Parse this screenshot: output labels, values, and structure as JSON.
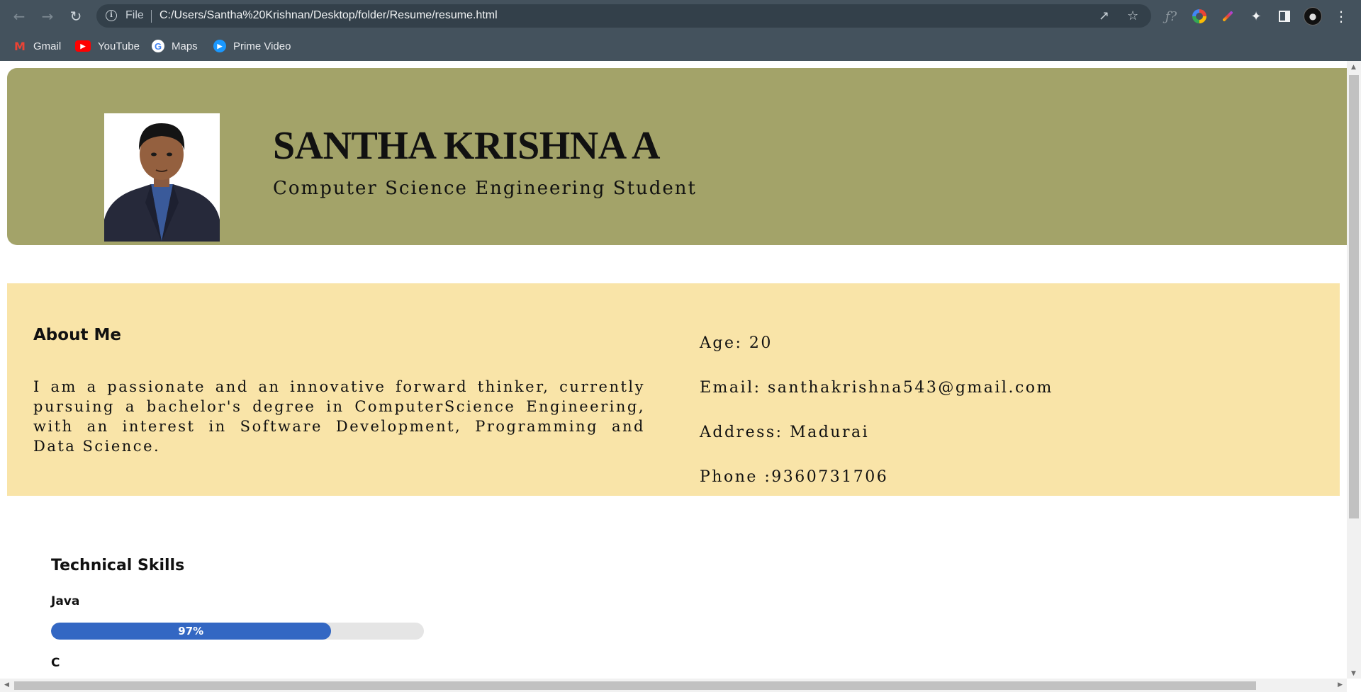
{
  "browser": {
    "omnibox": {
      "scheme_label": "File",
      "url": "C:/Users/Santha%20Krishnan/Desktop/folder/Resume/resume.html"
    },
    "bookmarks": [
      {
        "label": "Gmail",
        "icon": "gmail-icon"
      },
      {
        "label": "YouTube",
        "icon": "youtube-icon"
      },
      {
        "label": "Maps",
        "icon": "maps-icon"
      },
      {
        "label": "Prime Video",
        "icon": "prime-video-icon"
      }
    ]
  },
  "resume": {
    "name": "SANTHA KRISHNA A",
    "subtitle": "Computer Science Engineering Student",
    "about": {
      "title": "About Me",
      "text": "I am a passionate and an innovative forward thinker, currently pursuing a bachelor's degree in ComputerScience Engineering, with an interest in Software Development, Programming and Data Science."
    },
    "info": {
      "age": "Age: 20",
      "email": "Email: santhakrishna543@gmail.com",
      "address": "Address: Madurai",
      "phone": "Phone :9360731706"
    },
    "skills": {
      "title": "Technical Skills",
      "items": [
        {
          "name": "Java",
          "percent_label": "97%",
          "level": 0.75
        },
        {
          "name": "C"
        }
      ]
    }
  },
  "colors": {
    "header_bg": "#a3a369",
    "about_bg": "#f9e4a8",
    "skill_fill": "#3367c3",
    "chrome_bg": "#44525d"
  }
}
